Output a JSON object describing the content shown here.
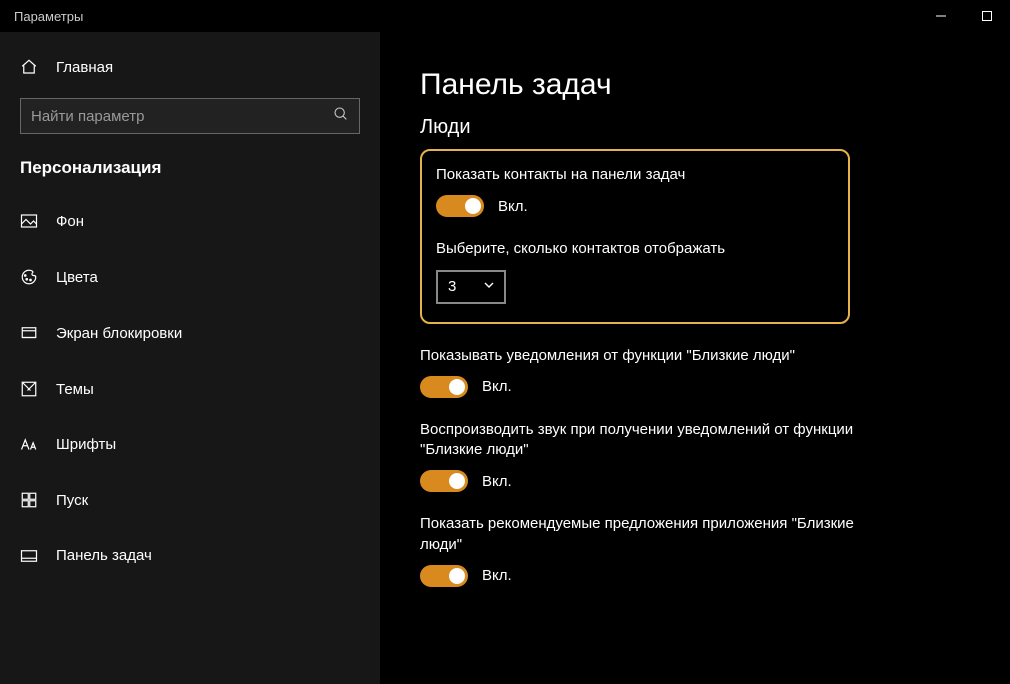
{
  "window": {
    "title": "Параметры"
  },
  "sidebar": {
    "home": "Главная",
    "search_placeholder": "Найти параметр",
    "category": "Персонализация",
    "items": [
      {
        "label": "Фон",
        "icon": "picture"
      },
      {
        "label": "Цвета",
        "icon": "palette"
      },
      {
        "label": "Экран блокировки",
        "icon": "lockscreen"
      },
      {
        "label": "Темы",
        "icon": "themes"
      },
      {
        "label": "Шрифты",
        "icon": "fonts"
      },
      {
        "label": "Пуск",
        "icon": "start"
      },
      {
        "label": "Панель задач",
        "icon": "taskbar"
      }
    ]
  },
  "main": {
    "title": "Панель задач",
    "section": "Люди",
    "highlight": {
      "show_contacts_label": "Показать контакты на панели задач",
      "show_contacts_state": "Вкл.",
      "count_label": "Выберите, сколько контактов отображать",
      "count_value": "3"
    },
    "settings": [
      {
        "label": "Показывать уведомления от функции \"Близкие люди\"",
        "state": "Вкл."
      },
      {
        "label": "Воспроизводить звук при получении уведомлений от функции \"Близкие люди\"",
        "state": "Вкл."
      },
      {
        "label": "Показать рекомендуемые предложения приложения \"Близкие люди\"",
        "state": "Вкл."
      }
    ]
  }
}
